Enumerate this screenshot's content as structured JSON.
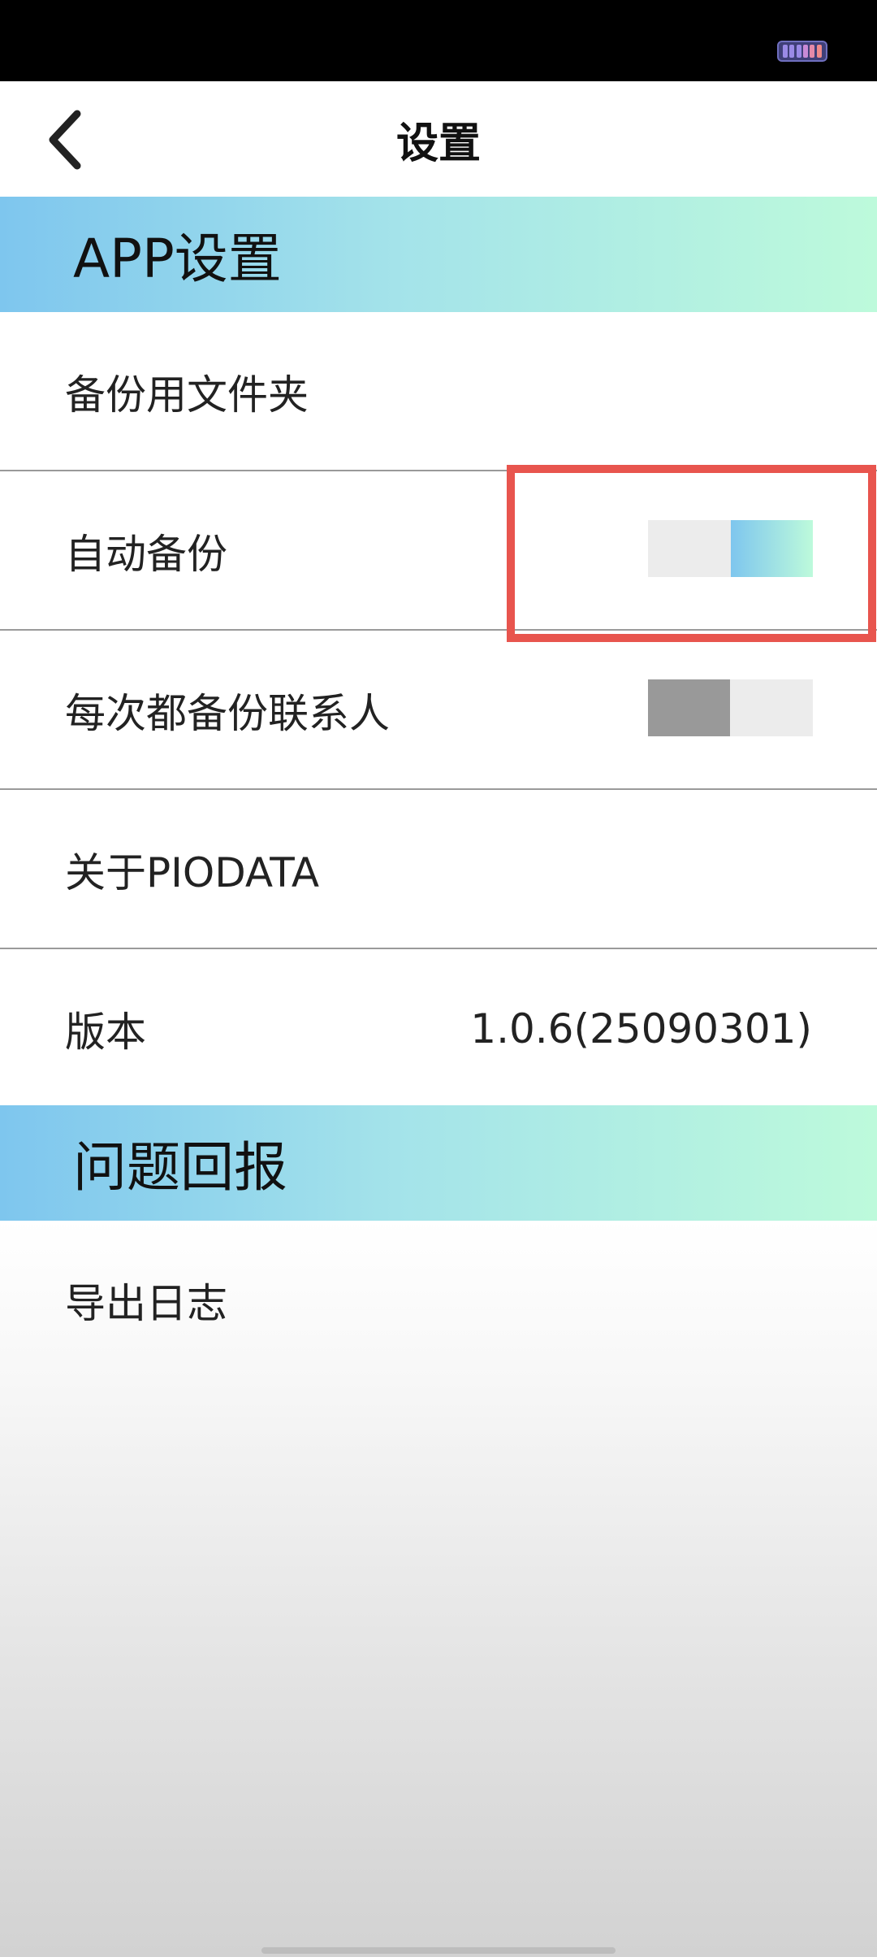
{
  "status_bar": {
    "battery_icon": "battery-icon"
  },
  "header": {
    "back_icon": "chevron-left-icon",
    "title": "设置"
  },
  "sections": {
    "app_settings": {
      "title": "APP设置",
      "backup_folder_label": "备份用文件夹",
      "auto_backup_label": "自动备份",
      "auto_backup_enabled": true,
      "backup_contacts_label": "每次都备份联系人",
      "backup_contacts_enabled": false,
      "about_label": "关于PIODATA",
      "version_label": "版本",
      "version_value": "1.0.6(25090301)"
    },
    "feedback": {
      "title": "问题回报",
      "export_log_label": "导出日志"
    }
  },
  "colors": {
    "gradient_start": "#7ec6ee",
    "gradient_end": "#bdfadb",
    "toggle_off_knob": "#999999",
    "highlight": "#e8554e"
  }
}
